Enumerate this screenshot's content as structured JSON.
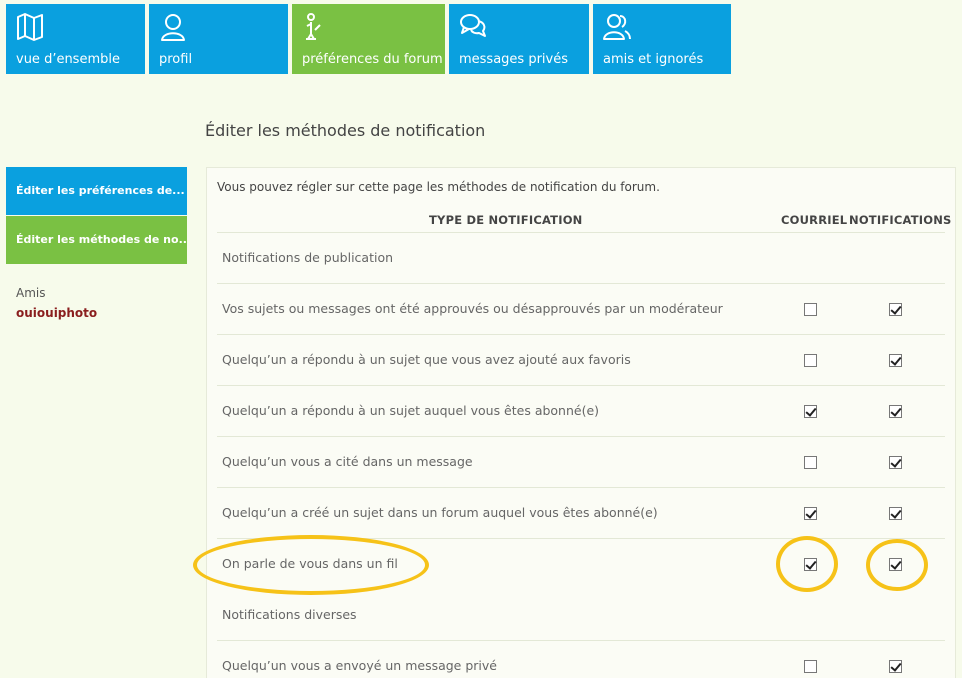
{
  "nav": {
    "tiles": [
      {
        "label": "vue d’ensemble",
        "icon": "map-icon"
      },
      {
        "label": "profil",
        "icon": "user-icon"
      },
      {
        "label": "préférences du forum",
        "icon": "settings-person-icon"
      },
      {
        "label": "messages privés",
        "icon": "chat-bubbles-icon"
      },
      {
        "label": "amis et ignorés",
        "icon": "friends-icon"
      }
    ]
  },
  "page_title": "Éditer les méthodes de notification",
  "sidebar": {
    "items": [
      {
        "label": "Éditer les préférences de..."
      },
      {
        "label": "Éditer les méthodes de no..."
      }
    ],
    "friends_label": "Amis",
    "friend_name": "ouiouiphoto"
  },
  "panel": {
    "intro": "Vous pouvez régler sur cette page les méthodes de notification du forum.",
    "columns": {
      "type": "TYPE DE NOTIFICATION",
      "email": "COURRIEL",
      "notif": "NOTIFICATIONS"
    },
    "rows": [
      {
        "label": "Notifications de publication"
      },
      {
        "label": "Vos sujets ou messages ont été approuvés ou désapprouvés par un modérateur",
        "email": false,
        "notif": true
      },
      {
        "label": "Quelqu’un a répondu à un sujet que vous avez ajouté aux favoris",
        "email": false,
        "notif": true
      },
      {
        "label": "Quelqu’un a répondu à un sujet auquel vous êtes abonné(e)",
        "email": true,
        "notif": true
      },
      {
        "label": "Quelqu’un vous a cité dans un message",
        "email": false,
        "notif": true
      },
      {
        "label": "Quelqu’un a créé un sujet dans un forum auquel vous êtes abonné(e)",
        "email": true,
        "notif": true
      },
      {
        "label": "On parle de vous dans un fil",
        "email": true,
        "notif": true
      },
      {
        "label": "Notifications diverses"
      },
      {
        "label": "Quelqu’un vous a envoyé un message privé",
        "email": false,
        "notif": true
      }
    ]
  },
  "colors": {
    "blue": "#0aa0df",
    "green": "#7ac143",
    "highlight": "#f6c218",
    "background": "#f7fbeb"
  }
}
